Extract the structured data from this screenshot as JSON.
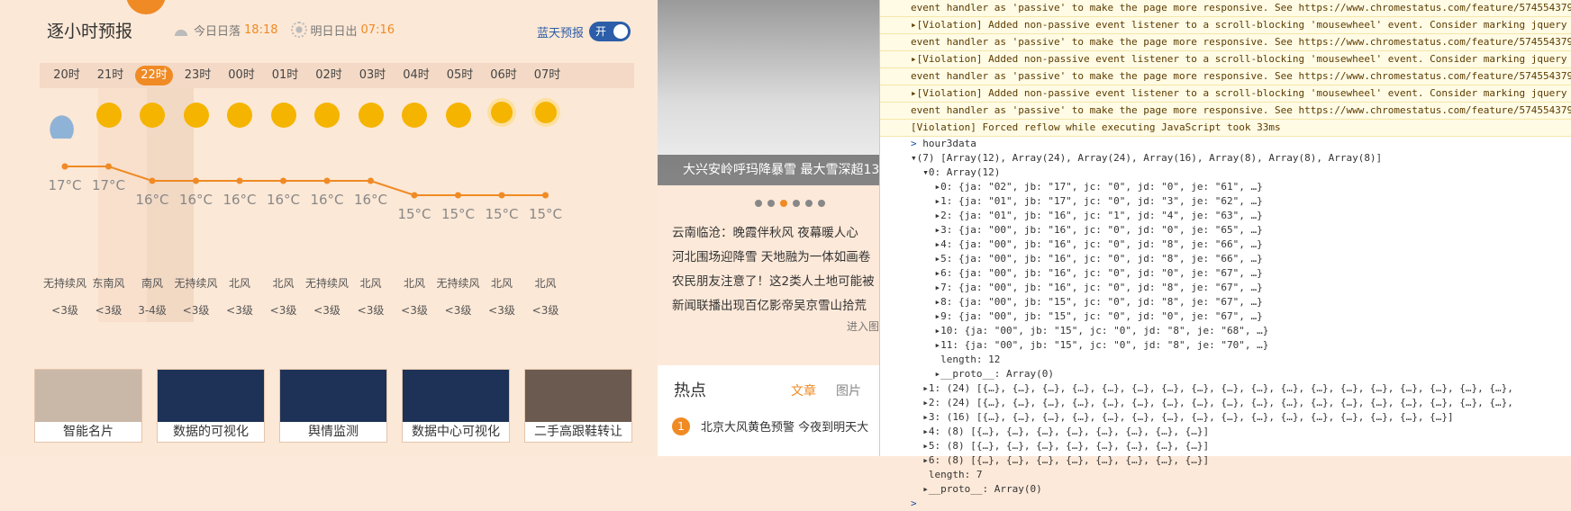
{
  "forecast": {
    "title": "逐小时预报",
    "sunset_label": "今日日落",
    "sunset_time": "18:18",
    "sunrise_label": "明日日出",
    "sunrise_time": "07:16",
    "blue_label": "蓝天预报",
    "switch_label": "开",
    "hours": [
      "20时",
      "21时",
      "22时",
      "23时",
      "00时",
      "01时",
      "02时",
      "03时",
      "04时",
      "05时",
      "06时",
      "07时"
    ],
    "icons": [
      "cloud-icon",
      "moon-cloud-icon",
      "moon-cloud-icon",
      "moon-icon",
      "moon-icon",
      "moon-icon",
      "moon-icon",
      "moon-icon",
      "moon-icon",
      "moon-icon",
      "sun-icon",
      "sun-icon"
    ],
    "temps": [
      "17°C",
      "17°C",
      "16°C",
      "16°C",
      "16°C",
      "16°C",
      "16°C",
      "16°C",
      "15°C",
      "15°C",
      "15°C",
      "15°C"
    ],
    "temp_values": [
      17,
      17,
      16,
      16,
      16,
      16,
      16,
      16,
      15,
      15,
      15,
      15
    ],
    "winds": [
      "无持续风",
      "东南风",
      "南风",
      "无持续风",
      "北风",
      "北风",
      "无持续风",
      "北风",
      "北风",
      "无持续风",
      "北风",
      "北风"
    ],
    "levels": [
      "<3级",
      "<3级",
      "3-4级",
      "<3级",
      "<3级",
      "<3级",
      "<3级",
      "<3级",
      "<3级",
      "<3级",
      "<3级",
      "<3级"
    ],
    "active_index": 2,
    "accent": "#f08a24"
  },
  "cards": [
    "智能名片",
    "数据的可视化",
    "舆情监测",
    "数据中心可视化",
    "二手高跟鞋转让"
  ],
  "slider": {
    "caption": "大兴安岭呼玛降暴雪 最大雪深超13"
  },
  "news": [
    "云南临沧：晚霞伴秋风 夜幕暖人心",
    "河北围场迎降雪 天地融为一体如画卷",
    "农民朋友注意了！这2类人土地可能被",
    "新闻联播出现百亿影帝吴京雪山拾荒"
  ],
  "news_more": "进入图",
  "hot": {
    "title": "热点",
    "tab_text": "文章",
    "tab_pic": "图片",
    "item_num": "1",
    "item_text": "北京大风黄色预警 今夜到明天大"
  },
  "console": {
    "violations": [
      "event handler as 'passive' to make the page more responsive. See https://www.chromestatus.com/feature/574554379",
      "▸[Violation] Added non-passive event listener to a scroll-blocking 'mousewheel' event. Consider marking  jquery",
      "event handler as 'passive' to make the page more responsive. See https://www.chromestatus.com/feature/574554379",
      "▸[Violation] Added non-passive event listener to a scroll-blocking 'mousewheel' event. Consider marking  jquery",
      "event handler as 'passive' to make the page more responsive. See https://www.chromestatus.com/feature/574554379",
      "▸[Violation] Added non-passive event listener to a scroll-blocking 'mousewheel' event. Consider marking  jquery",
      "event handler as 'passive' to make the page more responsive. See https://www.chromestatus.com/feature/574554379",
      "[Violation] Forced reflow while executing JavaScript took 33ms"
    ],
    "input": "hour3data",
    "lines": [
      "▾(7) [Array(12), Array(24), Array(24), Array(16), Array(8), Array(8), Array(8)]",
      "  ▾0: Array(12)",
      "    ▸0: {ja: \"02\", jb: \"17\", jc: \"0\", jd: \"0\", je: \"61\", …}",
      "    ▸1: {ja: \"01\", jb: \"17\", jc: \"0\", jd: \"3\", je: \"62\", …}",
      "    ▸2: {ja: \"01\", jb: \"16\", jc: \"1\", jd: \"4\", je: \"63\", …}",
      "    ▸3: {ja: \"00\", jb: \"16\", jc: \"0\", jd: \"0\", je: \"65\", …}",
      "    ▸4: {ja: \"00\", jb: \"16\", jc: \"0\", jd: \"8\", je: \"66\", …}",
      "    ▸5: {ja: \"00\", jb: \"16\", jc: \"0\", jd: \"8\", je: \"66\", …}",
      "    ▸6: {ja: \"00\", jb: \"16\", jc: \"0\", jd: \"0\", je: \"67\", …}",
      "    ▸7: {ja: \"00\", jb: \"16\", jc: \"0\", jd: \"8\", je: \"67\", …}",
      "    ▸8: {ja: \"00\", jb: \"15\", jc: \"0\", jd: \"8\", je: \"67\", …}",
      "    ▸9: {ja: \"00\", jb: \"15\", jc: \"0\", jd: \"0\", je: \"67\", …}",
      "    ▸10: {ja: \"00\", jb: \"15\", jc: \"0\", jd: \"8\", je: \"68\", …}",
      "    ▸11: {ja: \"00\", jb: \"15\", jc: \"0\", jd: \"8\", je: \"70\", …}",
      "     length: 12",
      "    ▸__proto__: Array(0)",
      "  ▸1: (24) [{…}, {…}, {…}, {…}, {…}, {…}, {…}, {…}, {…}, {…}, {…}, {…}, {…}, {…}, {…}, {…}, {…}, {…},",
      "  ▸2: (24) [{…}, {…}, {…}, {…}, {…}, {…}, {…}, {…}, {…}, {…}, {…}, {…}, {…}, {…}, {…}, {…}, {…}, {…},",
      "  ▸3: (16) [{…}, {…}, {…}, {…}, {…}, {…}, {…}, {…}, {…}, {…}, {…}, {…}, {…}, {…}, {…}, {…}]",
      "  ▸4: (8) [{…}, {…}, {…}, {…}, {…}, {…}, {…}, {…}]",
      "  ▸5: (8) [{…}, {…}, {…}, {…}, {…}, {…}, {…}, {…}]",
      "  ▸6: (8) [{…}, {…}, {…}, {…}, {…}, {…}, {…}, {…}]",
      "   length: 7",
      "  ▸__proto__: Array(0)"
    ]
  }
}
